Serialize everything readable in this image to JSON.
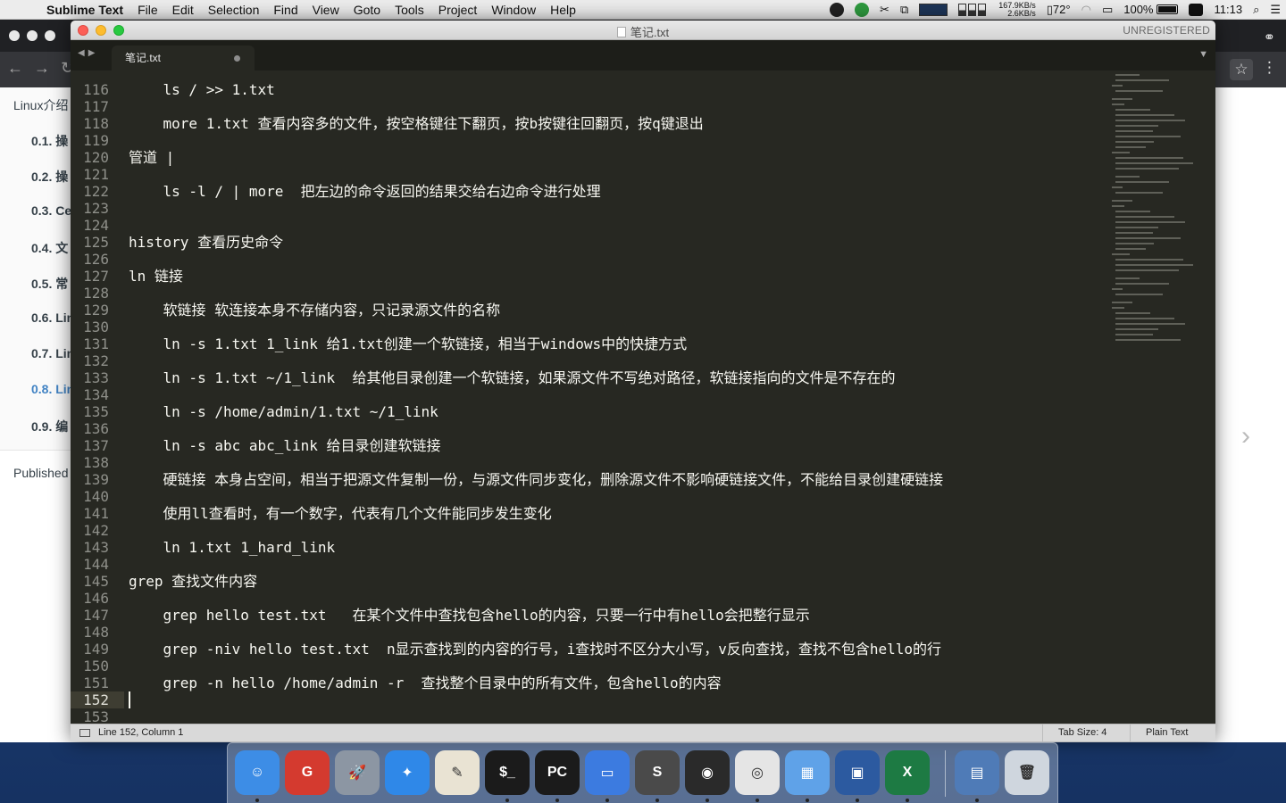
{
  "menubar": {
    "app_name": "Sublime Text",
    "items": [
      "File",
      "Edit",
      "Selection",
      "Find",
      "View",
      "Goto",
      "Tools",
      "Project",
      "Window",
      "Help"
    ],
    "net_up": "167.9KB/s",
    "net_down": "2.6KB/s",
    "temperature": "72°",
    "battery": "100%",
    "time": "11:13"
  },
  "browser": {
    "toc": [
      "Linux介绍",
      "0.1. 操",
      "0.2. 操",
      "0.3. Ce",
      "0.4. 文",
      "0.5. 常",
      "0.6. Lin",
      "0.7. Lin",
      "0.8. Lin",
      "0.9. 编"
    ],
    "published": "Published"
  },
  "sublime": {
    "window_title": "笔记.txt",
    "unregistered": "UNREGISTERED",
    "tab_label": "笔记.txt",
    "current_line": 152,
    "lines": [
      {
        "n": 116,
        "t": "    ls / >> 1.txt"
      },
      {
        "n": 117,
        "t": ""
      },
      {
        "n": 118,
        "t": "    more 1.txt 查看内容多的文件，按空格键往下翻页，按b按键往回翻页，按q键退出"
      },
      {
        "n": 119,
        "t": ""
      },
      {
        "n": 120,
        "t": "管道 |"
      },
      {
        "n": 121,
        "t": ""
      },
      {
        "n": 122,
        "t": "    ls -l / | more  把左边的命令返回的结果交给右边命令进行处理"
      },
      {
        "n": 123,
        "t": ""
      },
      {
        "n": 124,
        "t": ""
      },
      {
        "n": 125,
        "t": "history 查看历史命令"
      },
      {
        "n": 126,
        "t": ""
      },
      {
        "n": 127,
        "t": "ln 链接"
      },
      {
        "n": 128,
        "t": ""
      },
      {
        "n": 129,
        "t": "    软链接 软连接本身不存储内容，只记录源文件的名称"
      },
      {
        "n": 130,
        "t": ""
      },
      {
        "n": 131,
        "t": "    ln -s 1.txt 1_link 给1.txt创建一个软链接，相当于windows中的快捷方式"
      },
      {
        "n": 132,
        "t": ""
      },
      {
        "n": 133,
        "t": "    ln -s 1.txt ~/1_link  给其他目录创建一个软链接，如果源文件不写绝对路径，软链接指向的文件是不存在的"
      },
      {
        "n": 134,
        "t": ""
      },
      {
        "n": 135,
        "t": "    ln -s /home/admin/1.txt ~/1_link"
      },
      {
        "n": 136,
        "t": ""
      },
      {
        "n": 137,
        "t": "    ln -s abc abc_link 给目录创建软链接"
      },
      {
        "n": 138,
        "t": ""
      },
      {
        "n": 139,
        "t": "    硬链接 本身占空间，相当于把源文件复制一份，与源文件同步变化，删除源文件不影响硬链接文件，不能给目录创建硬链接"
      },
      {
        "n": 140,
        "t": ""
      },
      {
        "n": 141,
        "t": "    使用ll查看时，有一个数字，代表有几个文件能同步发生变化"
      },
      {
        "n": 142,
        "t": ""
      },
      {
        "n": 143,
        "t": "    ln 1.txt 1_hard_link"
      },
      {
        "n": 144,
        "t": ""
      },
      {
        "n": 145,
        "t": "grep 查找文件内容"
      },
      {
        "n": 146,
        "t": ""
      },
      {
        "n": 147,
        "t": "    grep hello test.txt   在某个文件中查找包含hello的内容，只要一行中有hello会把整行显示"
      },
      {
        "n": 148,
        "t": ""
      },
      {
        "n": 149,
        "t": "    grep -niv hello test.txt  n显示查找到的内容的行号，i查找时不区分大小写，v反向查找，查找不包含hello的行"
      },
      {
        "n": 150,
        "t": ""
      },
      {
        "n": 151,
        "t": "    grep -n hello /home/admin -r  查找整个目录中的所有文件，包含hello的内容"
      },
      {
        "n": 152,
        "t": ""
      },
      {
        "n": 153,
        "t": ""
      }
    ],
    "status": {
      "position": "Line 152, Column 1",
      "tab_size": "Tab Size: 4",
      "syntax": "Plain Text"
    }
  },
  "dock": {
    "apps": [
      {
        "name": "finder",
        "color": "#3d8de6",
        "glyph": "☺"
      },
      {
        "name": "git-client",
        "color": "#d43a2f",
        "glyph": "G"
      },
      {
        "name": "launchpad",
        "color": "#8c96a3",
        "glyph": "🚀"
      },
      {
        "name": "safari",
        "color": "#2f88e8",
        "glyph": "✦"
      },
      {
        "name": "textedit",
        "color": "#e9e3d3",
        "glyph": "✎"
      },
      {
        "name": "terminal",
        "color": "#1b1b1b",
        "glyph": "$_"
      },
      {
        "name": "pycharm",
        "color": "#1b1b1b",
        "glyph": "PC"
      },
      {
        "name": "keynote",
        "color": "#3c7be0",
        "glyph": "▭"
      },
      {
        "name": "sublime-text",
        "color": "#4a4a4a",
        "glyph": "S"
      },
      {
        "name": "obs",
        "color": "#2a2a2a",
        "glyph": "◉"
      },
      {
        "name": "chrome",
        "color": "#e5e5e5",
        "glyph": "◎"
      },
      {
        "name": "app-store-alt",
        "color": "#5fa2e8",
        "glyph": "▦"
      },
      {
        "name": "parallels",
        "color": "#2c5aa0",
        "glyph": "▣"
      },
      {
        "name": "excel",
        "color": "#1d7a43",
        "glyph": "X"
      },
      {
        "name": "screen-sharing",
        "color": "#4f7bb7",
        "glyph": "▤"
      },
      {
        "name": "trash",
        "color": "#cfd6de",
        "glyph": "🗑"
      }
    ]
  }
}
